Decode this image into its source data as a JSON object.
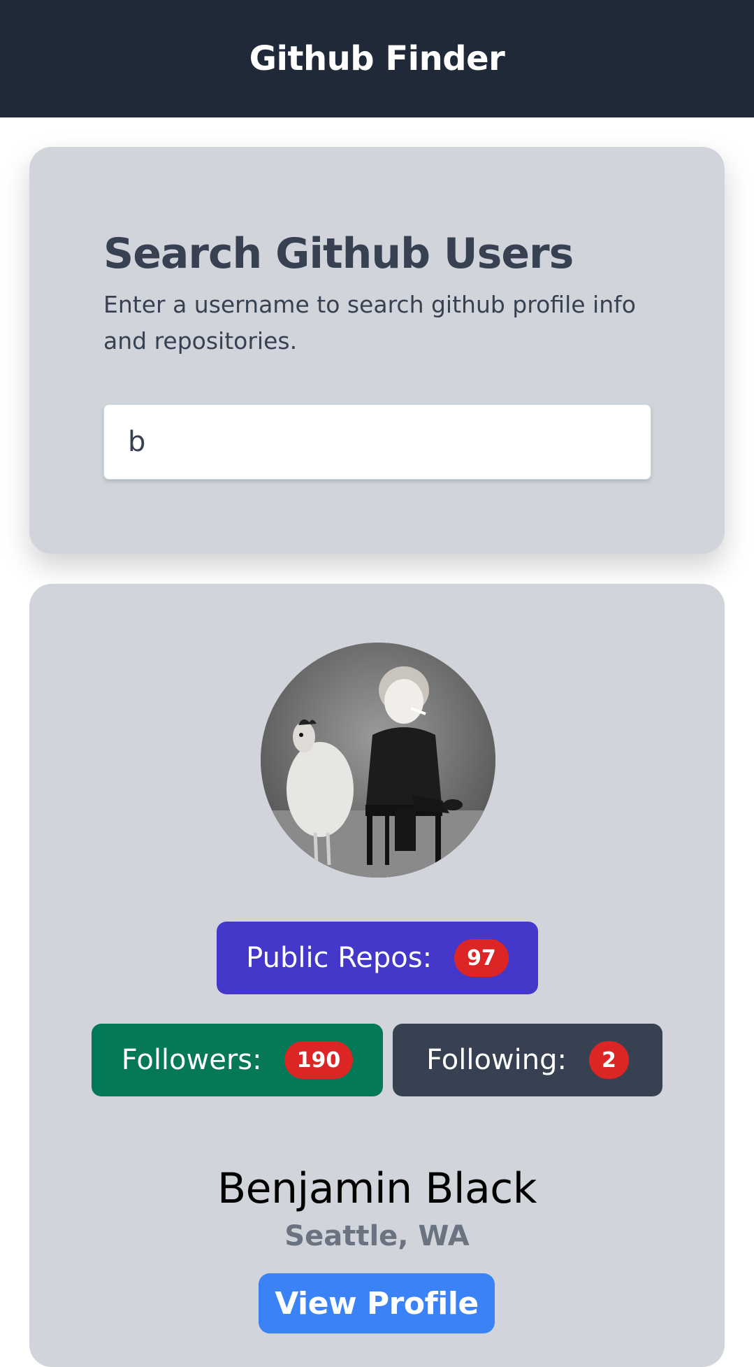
{
  "navbar": {
    "title": "Github Finder"
  },
  "search": {
    "heading": "Search Github Users",
    "description": "Enter a username to search github profile info and repositories.",
    "input_value": "b"
  },
  "profile": {
    "stats": {
      "public_repos_label": "Public Repos:",
      "public_repos": "97",
      "followers_label": "Followers:",
      "followers": "190",
      "following_label": "Following:",
      "following": "2"
    },
    "name": "Benjamin Black",
    "location": "Seattle, WA",
    "view_profile_label": "View Profile"
  },
  "colors": {
    "navbar": "#1f2937",
    "card": "#d1d5db",
    "repos": "#4338ca",
    "followers": "#047857",
    "following": "#374151",
    "count_badge": "#dc2626",
    "view_profile": "#3b82f6"
  }
}
